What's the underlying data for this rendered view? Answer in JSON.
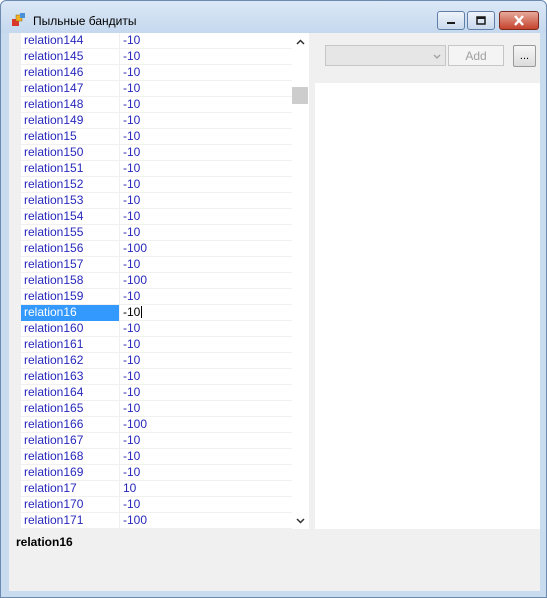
{
  "window": {
    "title": "Пыльные бандиты"
  },
  "grid": {
    "rows": [
      {
        "name": "relation144",
        "value": "-10"
      },
      {
        "name": "relation145",
        "value": "-10"
      },
      {
        "name": "relation146",
        "value": "-10"
      },
      {
        "name": "relation147",
        "value": "-10"
      },
      {
        "name": "relation148",
        "value": "-10"
      },
      {
        "name": "relation149",
        "value": "-10"
      },
      {
        "name": "relation15",
        "value": "-10"
      },
      {
        "name": "relation150",
        "value": "-10"
      },
      {
        "name": "relation151",
        "value": "-10"
      },
      {
        "name": "relation152",
        "value": "-10"
      },
      {
        "name": "relation153",
        "value": "-10"
      },
      {
        "name": "relation154",
        "value": "-10"
      },
      {
        "name": "relation155",
        "value": "-10"
      },
      {
        "name": "relation156",
        "value": "-100"
      },
      {
        "name": "relation157",
        "value": "-10"
      },
      {
        "name": "relation158",
        "value": "-100"
      },
      {
        "name": "relation159",
        "value": "-10"
      },
      {
        "name": "relation16",
        "value": "-10",
        "selected": true
      },
      {
        "name": "relation160",
        "value": "-10"
      },
      {
        "name": "relation161",
        "value": "-10"
      },
      {
        "name": "relation162",
        "value": "-10"
      },
      {
        "name": "relation163",
        "value": "-10"
      },
      {
        "name": "relation164",
        "value": "-10"
      },
      {
        "name": "relation165",
        "value": "-10"
      },
      {
        "name": "relation166",
        "value": "-100"
      },
      {
        "name": "relation167",
        "value": "-10"
      },
      {
        "name": "relation168",
        "value": "-10"
      },
      {
        "name": "relation169",
        "value": "-10"
      },
      {
        "name": "relation17",
        "value": "10"
      },
      {
        "name": "relation170",
        "value": "-10"
      },
      {
        "name": "relation171",
        "value": "-100"
      }
    ]
  },
  "toolbar": {
    "combo_value": "",
    "add_label": "Add",
    "ellipsis_label": "..."
  },
  "description": {
    "title": "relation16"
  },
  "icons": {
    "app": "app-icon",
    "minimize": "minimize-icon",
    "maximize": "maximize-icon",
    "close": "close-icon",
    "scroll_up": "chevron-up-icon",
    "scroll_down": "chevron-down-icon",
    "combo_arrow": "chevron-down-icon"
  },
  "colors": {
    "selection": "#3399ff",
    "value_text": "#2727bb",
    "close_button": "#c5432c"
  }
}
